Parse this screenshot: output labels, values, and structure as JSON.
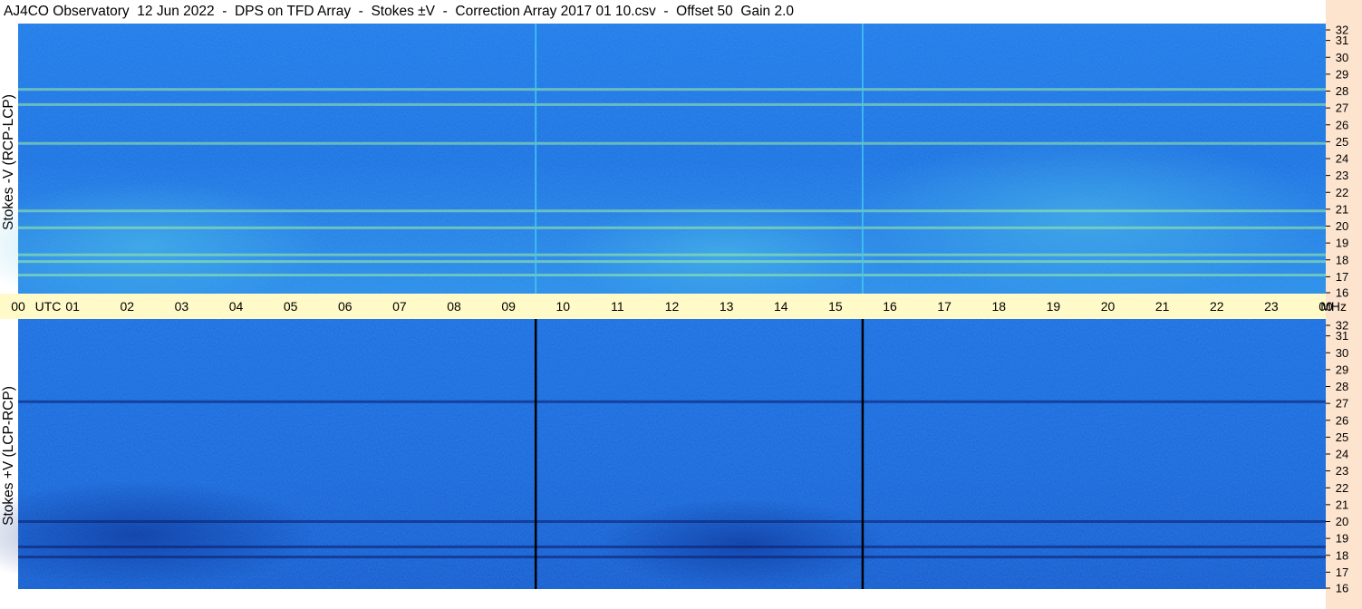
{
  "title": "AJ4CO Observatory  12 Jun 2022  -  DPS on TFD Array  -  Stokes ±V  -  Correction Array 2017 01 10.csv  -  Offset 50  Gain 2.0",
  "colors": {
    "background_blue": "#1a6ee0",
    "time_axis_band": "#fffac8",
    "freq_axis_strip": "#fde4cf"
  },
  "chart_data": [
    {
      "type": "heatmap",
      "panel": "top",
      "ylabel": "Stokes -V (RCP-LCP)",
      "y_unit": "MHz",
      "ylim": [
        16,
        32
      ],
      "y_ticks": [
        "32",
        "31",
        "30",
        "29",
        "28",
        "27",
        "26",
        "25",
        "24",
        "23",
        "22",
        "21",
        "20",
        "19",
        "18",
        "17",
        "16"
      ],
      "xlim_hours": [
        0,
        24
      ],
      "vertical_markers_hours": [
        9.5,
        15.5
      ],
      "bright_bands_mhz": [
        17.1,
        17.9,
        18.3,
        19.9,
        20.9,
        24.9,
        27.2,
        28.1
      ],
      "grid": false
    },
    {
      "type": "heatmap",
      "panel": "bottom",
      "ylabel": "Stokes +V (LCP-RCP)",
      "y_unit": "MHz",
      "ylim": [
        16,
        32
      ],
      "y_ticks": [
        "32",
        "31",
        "30",
        "29",
        "28",
        "27",
        "26",
        "25",
        "24",
        "23",
        "22",
        "21",
        "20",
        "19",
        "18",
        "17",
        "16"
      ],
      "xlim_hours": [
        0,
        24
      ],
      "vertical_markers_hours": [
        9.5,
        15.5
      ],
      "dark_bands_mhz": [
        17.9,
        18.5,
        20.0,
        27.1
      ],
      "grid": false
    }
  ],
  "time_axis": {
    "labels": [
      "00",
      "01",
      "02",
      "03",
      "04",
      "05",
      "06",
      "07",
      "08",
      "09",
      "10",
      "11",
      "12",
      "13",
      "14",
      "15",
      "16",
      "17",
      "18",
      "19",
      "20",
      "21",
      "22",
      "23",
      "00"
    ],
    "utc_label": "UTC",
    "unit_label": "MHz"
  }
}
